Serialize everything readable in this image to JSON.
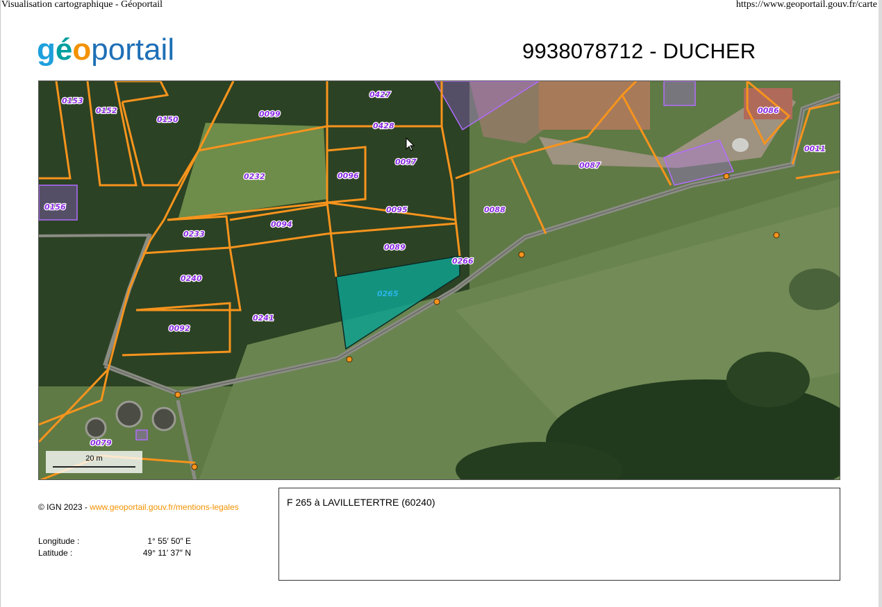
{
  "print_header": {
    "title": "Visualisation cartographique - Géoportail",
    "url": "https://www.geoportail.gouv.fr/carte"
  },
  "logo": {
    "part1": "géo",
    "part2": "portail"
  },
  "document_title": "9938078712 - DUCHER",
  "map": {
    "scale_label": "20 m",
    "selected_parcel": "0265",
    "parcel_labels": [
      "0153",
      "0152",
      "0150",
      "0099",
      "0427",
      "0428",
      "0097",
      "0232",
      "0096",
      "0095",
      "0088",
      "0087",
      "0086",
      "0011",
      "0156",
      "0094",
      "0233",
      "0089",
      "0266",
      "0265",
      "0240",
      "0241",
      "0092",
      "0079"
    ],
    "colors": {
      "parcel_border": "#f7941d",
      "parcel_label": "#8a2be2",
      "selected_fill": "#0fa08e",
      "building_outline": "#b26cff"
    }
  },
  "copyright": {
    "prefix": "© IGN 2023 - ",
    "link": "www.geoportail.gouv.fr/mentions-legales"
  },
  "coordinates": {
    "longitude_label": "Longitude :",
    "longitude_value": "1° 55′ 50″ E",
    "latitude_label": "Latitude :",
    "latitude_value": "49° 11′ 37″ N"
  },
  "comment": "F 265 à LAVILLETERTRE (60240)"
}
